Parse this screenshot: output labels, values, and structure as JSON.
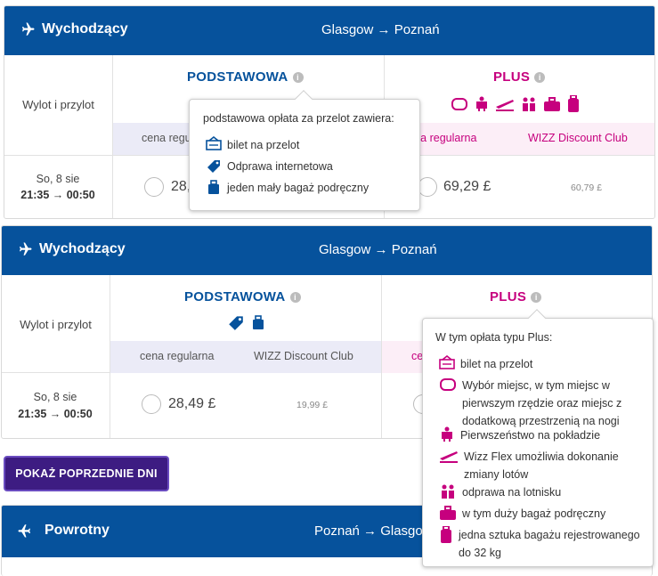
{
  "outbound_1": {
    "direction": "Wychodzący",
    "route": "Glasgow → Poznań",
    "col_label": "Wylot i przylot",
    "basic_title": "PODSTAWOWA",
    "plus_title": "PLUS",
    "basic_regular": "cena regularna",
    "plus_regular": "cena regularna",
    "plus_club": "WIZZ Discount Club",
    "date": "So, 8 sie",
    "time": "21:35 → 00:50",
    "basic_price": "28,",
    "plus_price": "69,29 £",
    "plus_club_price": "60,79 £"
  },
  "tooltip_basic": {
    "title": "podstawowa opłata za przelot zawiera:",
    "items": [
      "bilet na przelot",
      "Odprawa internetowa",
      "jeden mały bagaż podręczny"
    ]
  },
  "outbound_2": {
    "direction": "Wychodzący",
    "route": "Glasgow → Poznań",
    "col_label": "Wylot i przylot",
    "basic_title": "PODSTAWOWA",
    "plus_title": "PLUS",
    "basic_regular": "cena regularna",
    "basic_club": "WIZZ Discount Club",
    "plus_regular": "cen",
    "date": "So, 8 sie",
    "time": "21:35 → 00:50",
    "basic_price": "28,49 £",
    "basic_club_price": "19,99 £"
  },
  "tooltip_plus": {
    "title": "W tym opłata typu Plus:",
    "items": [
      "bilet na przelot",
      "Wybór miejsc, w tym miejsc w pierwszym rzędzie oraz miejsc z dodatkową przestrzenią na nogi",
      "Pierwszeństwo na pokładzie",
      "Wizz Flex umożliwia dokonanie zmiany lotów",
      "odprawa na lotnisku",
      "w tym duży bagaż podręczny",
      "jedna sztuka bagażu rejestrowanego do 32 kg"
    ]
  },
  "prev_days_button": "POKAŻ POPRZEDNIE DNI",
  "return": {
    "direction": "Powrotny",
    "route": "Poznań → Glasgo"
  },
  "colors": {
    "header_blue": "#06529c",
    "plus_magenta": "#c6007e",
    "button_purple": "#3d1c82"
  }
}
